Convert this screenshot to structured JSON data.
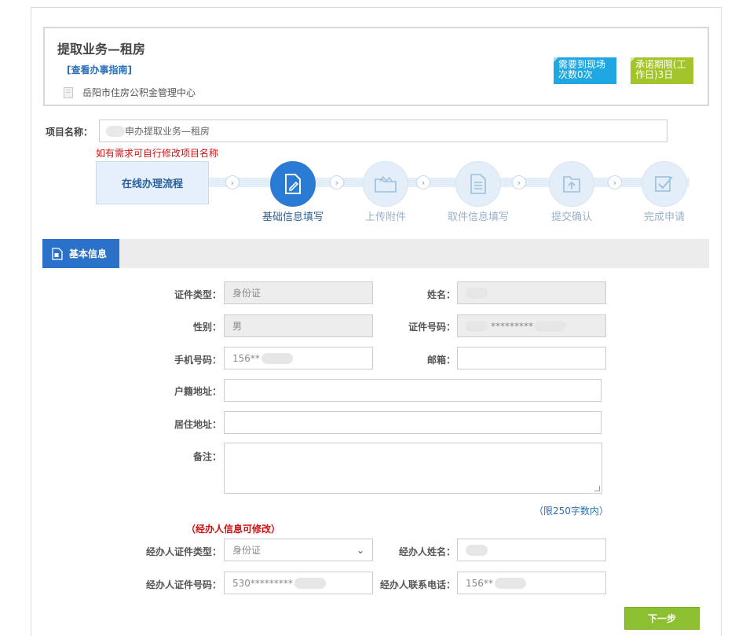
{
  "header": {
    "title": "提取业务—租房",
    "guide_link": "[查看办事指南]",
    "center_name": "岳阳市住房公积金管理中心",
    "badge_visits": "需要到现场次数0次",
    "badge_deadline": "承诺期限(工作日)3日"
  },
  "project": {
    "label": "项目名称：",
    "value": "申办提取业务—租房",
    "hint": "如有需求可自行修改项目名称"
  },
  "flow": {
    "title": "在线办理流程",
    "steps": [
      {
        "label": "基础信息填写",
        "icon": "pencil-icon",
        "active": true
      },
      {
        "label": "上传附件",
        "icon": "folder-open-icon",
        "active": false
      },
      {
        "label": "取件信息填写",
        "icon": "document-icon",
        "active": false
      },
      {
        "label": "提交确认",
        "icon": "folder-upload-icon",
        "active": false
      },
      {
        "label": "完成申请",
        "icon": "checkbox-icon",
        "active": false
      }
    ],
    "arrow": "›"
  },
  "tab": {
    "label": "基本信息",
    "icon": "id-card-icon"
  },
  "form": {
    "id_type_label": "证件类型：",
    "id_type_value": "身份证",
    "name_label": "姓名：",
    "name_value": "",
    "gender_label": "性别：",
    "gender_value": "男",
    "id_no_label": "证件号码：",
    "id_no_value": "*********",
    "phone_label": "手机号码：",
    "phone_value": "156**",
    "email_label": "邮箱：",
    "email_value": "",
    "hukou_label": "户籍地址：",
    "hukou_value": "",
    "address_label": "居住地址：",
    "address_value": "",
    "note_label": "备注：",
    "note_limit": "（限250字数内）"
  },
  "agent": {
    "hint": "（经办人信息可修改）",
    "id_type_label": "经办人证件类型：",
    "id_type_value": "身份证",
    "name_label": "经办人姓名：",
    "name_value": "",
    "id_no_label": "经办人证件号码：",
    "id_no_value": "530*********",
    "phone_label": "经办人联系电话：",
    "phone_value": "156**"
  },
  "actions": {
    "next": "下一步"
  },
  "colors": {
    "primary": "#2a72c9",
    "accent_green": "#8cc031",
    "badge_blue": "#1ea7e0",
    "badge_green": "#a3c52b",
    "warning_red": "#d01010"
  }
}
